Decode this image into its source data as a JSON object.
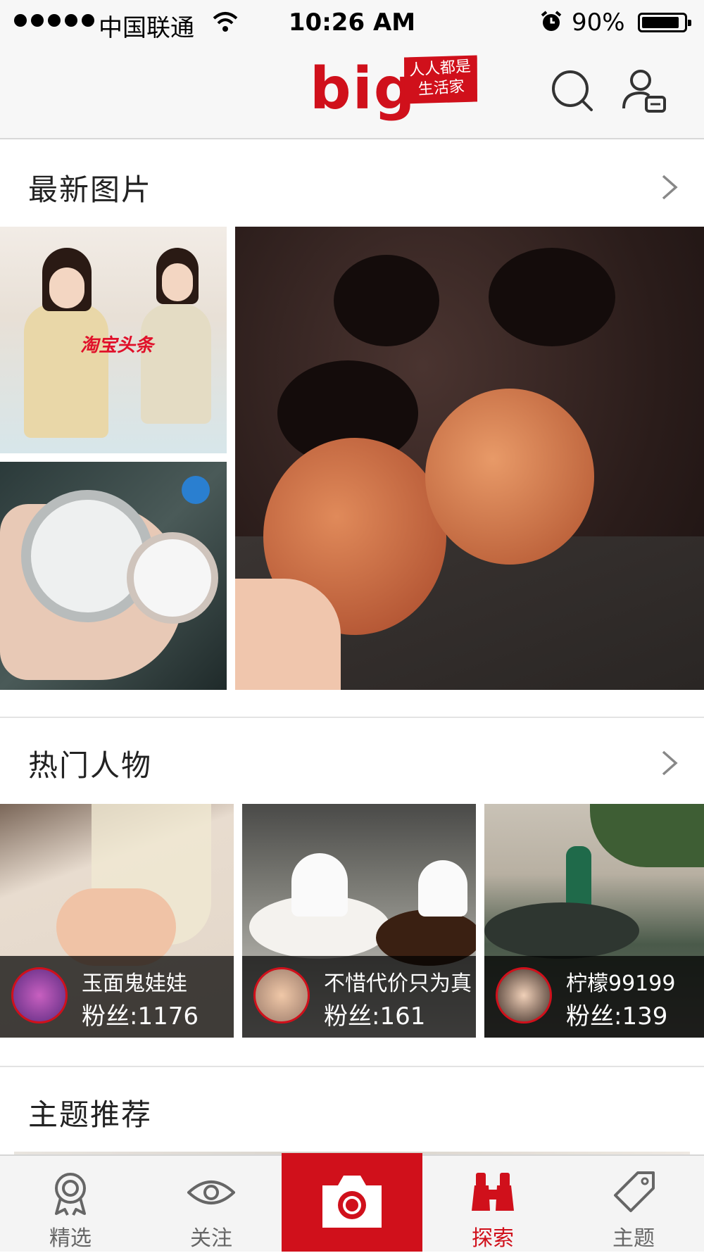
{
  "status_bar": {
    "carrier": "中国联通",
    "time": "10:26 AM",
    "battery": "90%"
  },
  "nav_bar": {
    "logo": "big",
    "slogan_line1": "人人都是",
    "slogan_line2": "生活家"
  },
  "latest_photos": {
    "title": "最新图片",
    "photo_tag": "淘宝头条"
  },
  "hot_people": {
    "title": "热门人物",
    "people": [
      {
        "name": "玉面鬼娃娃",
        "fans": "粉丝:1176"
      },
      {
        "name": "不惜代价只为真",
        "fans": "粉丝:161"
      },
      {
        "name": "柠檬99199",
        "fans": "粉丝:139"
      }
    ]
  },
  "topics": {
    "title": "主题推荐"
  },
  "tab_bar": {
    "tabs": [
      {
        "label": "精选",
        "icon": "award-icon"
      },
      {
        "label": "关注",
        "icon": "eye-icon"
      },
      {
        "label": "",
        "icon": "camera-icon"
      },
      {
        "label": "探索",
        "icon": "binoculars-icon"
      },
      {
        "label": "主题",
        "icon": "tag-icon"
      }
    ],
    "active": "探索"
  },
  "colors": {
    "brand_red": "#d0101b",
    "text": "#222222",
    "tab_inactive": "#666666"
  }
}
